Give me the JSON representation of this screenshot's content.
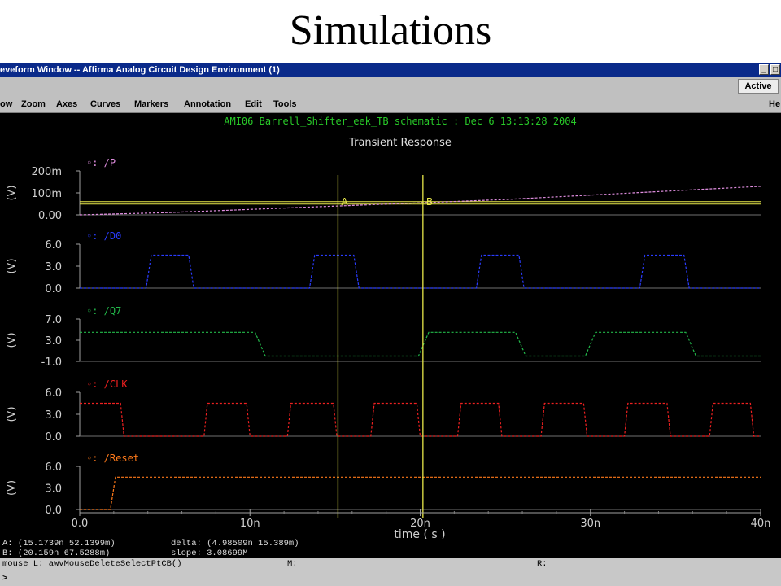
{
  "slide": {
    "title": "Simulations"
  },
  "window": {
    "title": "eveform Window -- Affirma Analog Circuit Design Environment (1)",
    "minimize_glyph": "_",
    "maximize_glyph": "□",
    "status_badge": "Active"
  },
  "menu": {
    "items": [
      "ow",
      "Zoom",
      "Axes",
      "Curves",
      "Markers",
      "Annotation",
      "Edit",
      "Tools"
    ],
    "help": "He"
  },
  "plot": {
    "header": "AMI06 Barrell_Shifter_eek_TB schematic : Dec  6 13:13:28 2004",
    "analysis": "Transient Response",
    "unit_label": "(V)",
    "marker_a": "A",
    "marker_b": "B",
    "x_ticks": [
      "0.0",
      "10n",
      "20n",
      "30n",
      "40n"
    ],
    "xlabel": "time ( s )"
  },
  "chart_data": {
    "type": "line",
    "title": "Transient Response",
    "xlabel": "time ( s )",
    "xlim": [
      0,
      40
    ],
    "x_units": "ns",
    "markers": [
      {
        "name": "A",
        "x": 15.17
      },
      {
        "name": "B",
        "x": 20.16
      }
    ],
    "series": [
      {
        "name": "/P",
        "color": "#e08ee0",
        "ylabel": "(V)",
        "ylim": [
          0,
          0.2
        ],
        "ytick_labels": [
          "200m",
          "100m",
          "0.00"
        ],
        "hline": 0.06,
        "x": [
          0,
          5,
          10,
          15,
          20,
          25,
          30,
          35,
          40
        ],
        "values": [
          0,
          0.01,
          0.025,
          0.04,
          0.055,
          0.07,
          0.09,
          0.11,
          0.13
        ]
      },
      {
        "name": "/D0",
        "color": "#2a3cff",
        "ylabel": "(V)",
        "ylim": [
          0,
          6
        ],
        "ytick_labels": [
          "6.0",
          "3.0",
          "0.0"
        ],
        "x": [
          0,
          3.9,
          4.2,
          6.4,
          6.7,
          13.5,
          13.8,
          16.1,
          16.4,
          23.3,
          23.6,
          25.8,
          26.1,
          32.9,
          33.2,
          35.5,
          35.8,
          40
        ],
        "values": [
          0,
          0,
          4.5,
          4.5,
          0,
          0,
          4.5,
          4.5,
          0,
          0,
          4.5,
          4.5,
          0,
          0,
          4.5,
          4.5,
          0,
          0
        ]
      },
      {
        "name": "/Q7",
        "color": "#22b84a",
        "ylabel": "(V)",
        "ylim": [
          -1,
          7
        ],
        "ytick_labels": [
          "7.0",
          "3.0",
          "-1.0"
        ],
        "x": [
          0,
          10.3,
          10.9,
          19.9,
          20.5,
          25.6,
          26.2,
          29.7,
          30.3,
          35.6,
          36.2,
          40
        ],
        "values": [
          4.5,
          4.5,
          0,
          0,
          4.5,
          4.5,
          0,
          0,
          4.5,
          4.5,
          0,
          0
        ]
      },
      {
        "name": "/CLK",
        "color": "#ee2020",
        "ylabel": "(V)",
        "ylim": [
          0,
          6
        ],
        "ytick_labels": [
          "6.0",
          "3.0",
          "0.0"
        ],
        "x": [
          0,
          2.4,
          2.6,
          7.3,
          7.5,
          9.8,
          10.0,
          12.2,
          12.4,
          14.9,
          15.1,
          17.1,
          17.3,
          19.8,
          20.0,
          22.2,
          22.4,
          24.6,
          24.8,
          27.1,
          27.3,
          29.6,
          29.8,
          32.0,
          32.2,
          34.5,
          34.7,
          37.0,
          37.2,
          39.4,
          39.6,
          40
        ],
        "values": [
          4.5,
          4.5,
          0,
          0,
          4.5,
          4.5,
          0,
          0,
          4.5,
          4.5,
          0,
          0,
          4.5,
          4.5,
          0,
          0,
          4.5,
          4.5,
          0,
          0,
          4.5,
          4.5,
          0,
          0,
          4.5,
          4.5,
          0,
          0,
          4.5,
          4.5,
          0,
          0
        ]
      },
      {
        "name": "/Reset",
        "color": "#ff7a1a",
        "ylabel": "(V)",
        "ylim": [
          0,
          6
        ],
        "ytick_labels": [
          "6.0",
          "3.0",
          "0.0"
        ],
        "x": [
          0,
          1.8,
          2.1,
          40
        ],
        "values": [
          0,
          0,
          4.5,
          4.5
        ]
      }
    ]
  },
  "info": {
    "a_readout": "A: (15.1739n 52.1399m)",
    "b_readout": "B: (20.159n 67.5288m)",
    "delta": "delta: (4.98509n 15.389m)",
    "slope": "slope: 3.08699M"
  },
  "cmd": {
    "mouse_l": "mouse L: awvMouseDeleteSelectPtCB()",
    "m_label": "M:",
    "r_label": "R:",
    "prompt": ">"
  }
}
